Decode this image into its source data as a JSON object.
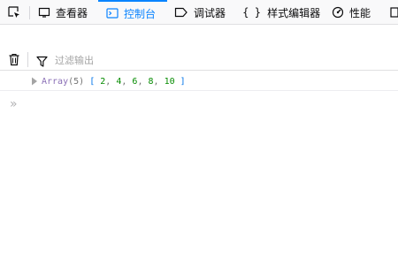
{
  "toolbar": {
    "tabs": [
      {
        "label": "查看器",
        "icon": "inspector-icon"
      },
      {
        "label": "控制台",
        "icon": "console-icon",
        "active": true
      },
      {
        "label": "调试器",
        "icon": "debugger-icon"
      },
      {
        "label": "样式编辑器",
        "icon": "braces-icon"
      },
      {
        "label": "性能",
        "icon": "performance-icon"
      }
    ],
    "accent": "#0a84ff"
  },
  "filter": {
    "placeholder": "过滤输出"
  },
  "console": {
    "messages": [
      {
        "title": "Array",
        "length": "(5)",
        "open_bracket": "[",
        "items": [
          "2",
          "4",
          "6",
          "8",
          "10"
        ],
        "close_bracket": "]"
      }
    ],
    "prompt_symbol": "»"
  }
}
